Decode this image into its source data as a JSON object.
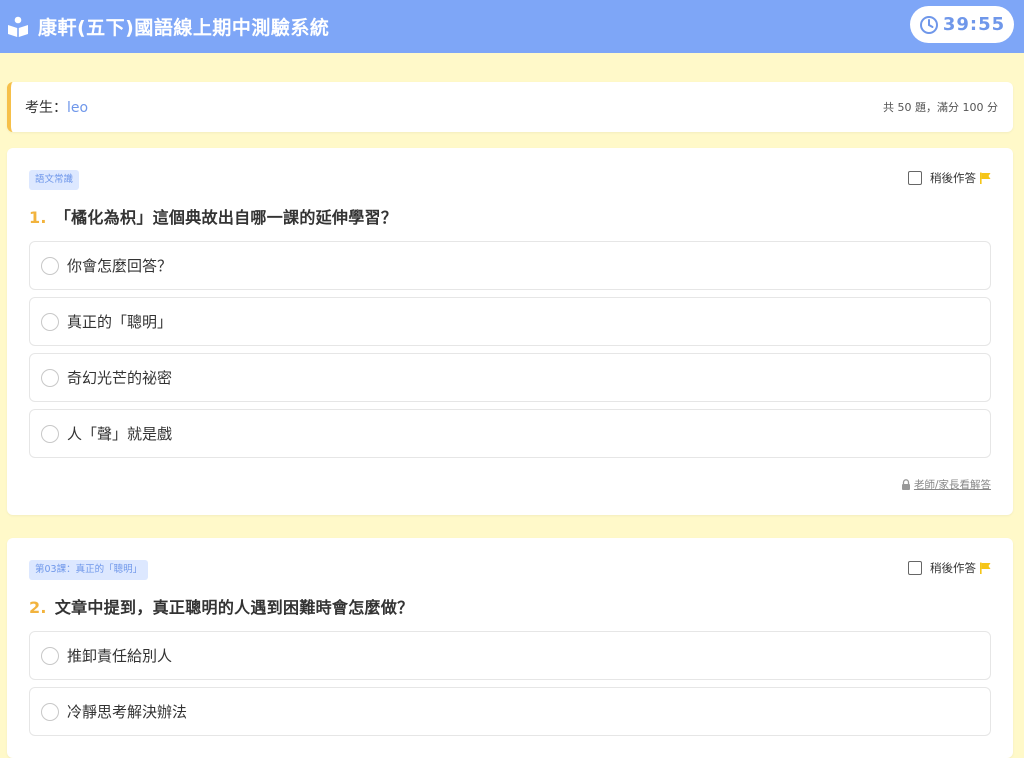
{
  "header": {
    "title": "康軒(五下)國語線上期中測驗系統",
    "timer": "39:55",
    "icon": "reading-child-icon"
  },
  "student": {
    "label": "考生：",
    "name": "leo",
    "exam_info": "共 50 題，滿分 100 分"
  },
  "questions": [
    {
      "tag": "語文常識",
      "number": "1.",
      "text": "「橘化為枳」這個典故出自哪一課的延伸學習？",
      "later_label": "稍後作答",
      "options": [
        "你會怎麼回答？",
        "真正的「聰明」",
        "奇幻光芒的祕密",
        "人「聲」就是戲"
      ],
      "answer_link": "老師/家長看解答"
    },
    {
      "tag": "第03課：真正的「聰明」",
      "number": "2.",
      "text": "文章中提到，真正聰明的人遇到困難時會怎麼做？",
      "later_label": "稍後作答",
      "options": [
        "推卸責任給別人",
        "冷靜思考解決辦法"
      ]
    }
  ],
  "colors": {
    "accent": "#7ea6f7",
    "background": "#fff9c9",
    "question_number": "#f2b33d",
    "flag": "#f5c518"
  }
}
